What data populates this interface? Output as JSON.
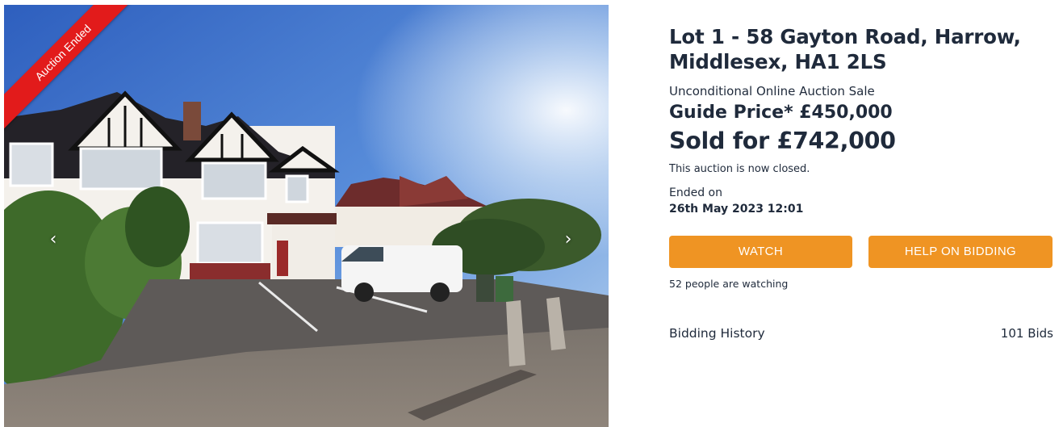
{
  "gallery": {
    "badge": "Auction Ended",
    "prev_icon": "‹",
    "next_icon": "›",
    "icons": [
      "chevron-left-icon",
      "chevron-right-icon"
    ],
    "badge_color": "#e21b1b"
  },
  "lot": {
    "title": "Lot 1 - 58 Gayton Road, Harrow, Middlesex, HA1 2LS",
    "sale_type": "Unconditional Online Auction Sale",
    "guide_price": "Guide Price* £450,000",
    "sold_price": "Sold for £742,000",
    "closed_note": "This auction is now closed.",
    "ended_label": "Ended on",
    "ended_date": "26th May 2023 12:01"
  },
  "actions": {
    "watch_label": "WATCH",
    "help_label": "HELP ON BIDDING",
    "button_color": "#ef9423",
    "watching_text": "52 people are watching"
  },
  "bidding": {
    "label": "Bidding History",
    "count": "101 Bids"
  }
}
